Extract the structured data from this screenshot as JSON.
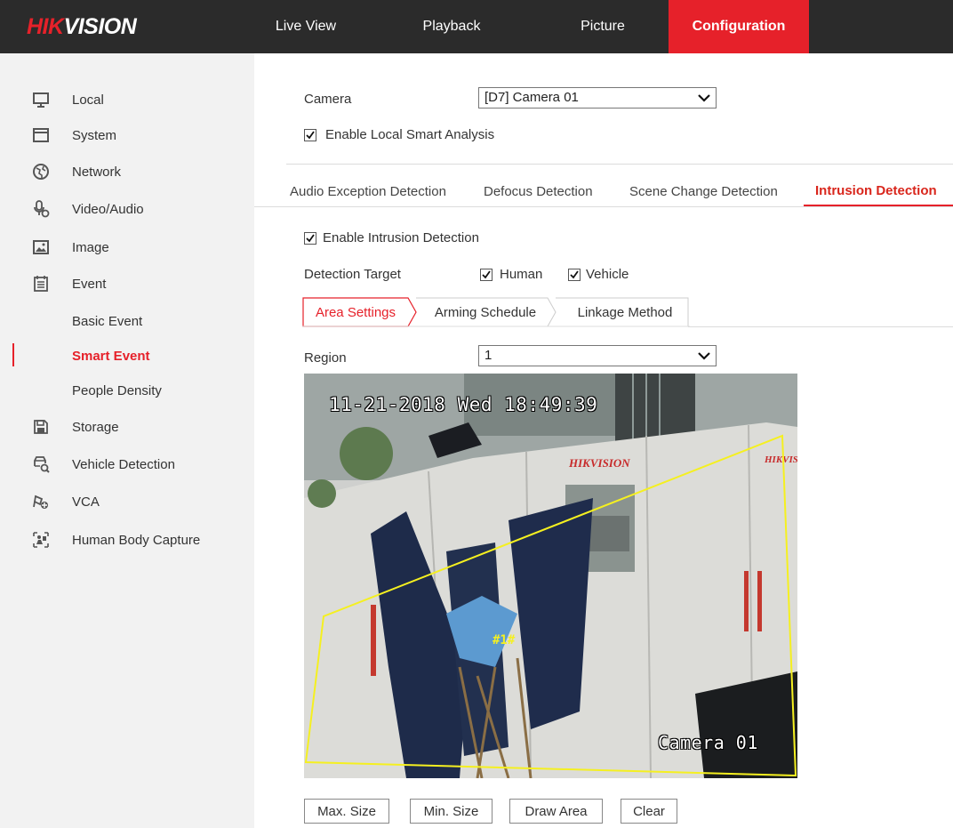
{
  "brand": {
    "hik": "HIK",
    "vision": "VISION"
  },
  "nav": [
    {
      "label": "Live View"
    },
    {
      "label": "Playback"
    },
    {
      "label": "Picture"
    },
    {
      "label": "Configuration",
      "active": true
    }
  ],
  "sidebar": {
    "items": [
      {
        "label": "Local",
        "icon": "monitor-icon"
      },
      {
        "label": "System",
        "icon": "window-icon"
      },
      {
        "label": "Network",
        "icon": "globe-icon"
      },
      {
        "label": "Video/Audio",
        "icon": "microphone-icon"
      },
      {
        "label": "Image",
        "icon": "image-icon"
      },
      {
        "label": "Event",
        "icon": "calendar-icon"
      },
      {
        "label": "Basic Event"
      },
      {
        "label": "Smart Event",
        "active": true
      },
      {
        "label": "People Density"
      },
      {
        "label": "Storage",
        "icon": "save-icon"
      },
      {
        "label": "Vehicle Detection",
        "icon": "vehicle-search-icon"
      },
      {
        "label": "VCA",
        "icon": "vca-icon"
      },
      {
        "label": "Human Body Capture",
        "icon": "body-capture-icon"
      }
    ]
  },
  "camera": {
    "label": "Camera",
    "value": "[D7] Camera 01"
  },
  "local_smart": {
    "label": "Enable Local Smart Analysis",
    "checked": true
  },
  "tabs": [
    {
      "label": "Audio Exception Detection"
    },
    {
      "label": "Defocus Detection"
    },
    {
      "label": "Scene Change Detection"
    },
    {
      "label": "Intrusion Detection",
      "active": true
    }
  ],
  "intrusion": {
    "enable_label": "Enable Intrusion Detection",
    "checked": true
  },
  "detection_target": {
    "label": "Detection Target",
    "human": {
      "label": "Human",
      "checked": true
    },
    "vehicle": {
      "label": "Vehicle",
      "checked": true
    }
  },
  "steps": [
    {
      "label": "Area Settings",
      "active": true
    },
    {
      "label": "Arming Schedule"
    },
    {
      "label": "Linkage Method"
    }
  ],
  "region": {
    "label": "Region",
    "value": "1"
  },
  "video": {
    "timestamp": "11-21-2018 Wed 18:49:39",
    "camera_name": "Camera 01",
    "region_tag": "#1#",
    "wall_brand": "HIKVISION",
    "region_color": "#f5f020"
  },
  "buttons": {
    "max_size": "Max. Size",
    "min_size": "Min. Size",
    "draw_area": "Draw Area",
    "clear": "Clear"
  },
  "colors": {
    "accent": "#e6212a",
    "topbar": "#2b2b2b",
    "sidebar": "#f2f2f2"
  }
}
